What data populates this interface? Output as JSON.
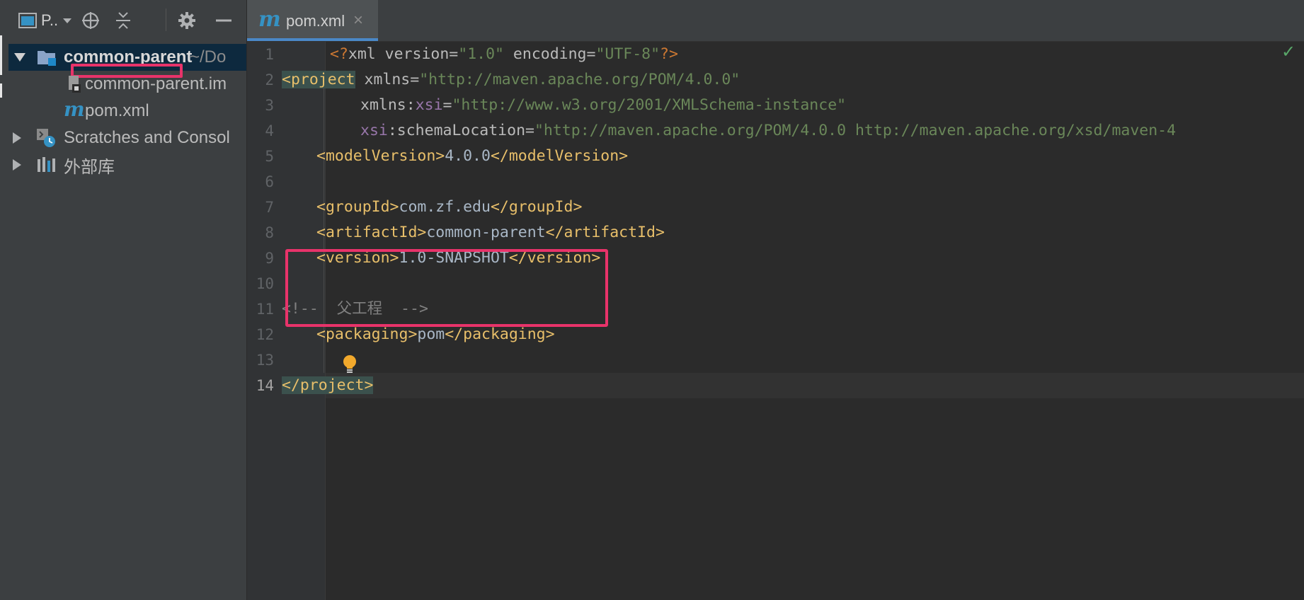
{
  "project_panel": {
    "title": "P..",
    "tree": [
      {
        "label": "common-parent",
        "suffix": "~/Do",
        "expanded": true,
        "selected": true
      },
      {
        "label": "common-parent.im"
      },
      {
        "label": "pom.xml",
        "icon_glyph": "m"
      },
      {
        "label": "Scratches and Consol"
      },
      {
        "label": "外部库"
      }
    ]
  },
  "tab": {
    "icon_glyph": "m",
    "label": "pom.xml",
    "close": "×"
  },
  "editor": {
    "line_numbers": [
      "1",
      "2",
      "3",
      "4",
      "5",
      "6",
      "7",
      "8",
      "9",
      "10",
      "11",
      "12",
      "13",
      "14"
    ],
    "current_line": "14",
    "inspection_status": "✓"
  },
  "code": {
    "l1": {
      "open": "<?",
      "name": "xml",
      "a1": " version",
      "eq1": "=",
      "v1": "\"1.0\"",
      "a2": " encoding",
      "eq2": "=",
      "v2": "\"UTF-8\"",
      "close": "?>"
    },
    "l2": {
      "tag": "<project",
      "attr": " xmlns",
      "eq": "=",
      "val": "\"http://maven.apache.org/POM/4.0.0\""
    },
    "l3": {
      "attr": "xmlns",
      "colon": ":",
      "ns": "xsi",
      "eq": "=",
      "val": "\"http://www.w3.org/2001/XMLSchema-instance\""
    },
    "l4": {
      "ns": "xsi",
      "colon": ":",
      "attr": "schemaLocation",
      "eq": "=",
      "val": "\"http://maven.apache.org/POM/4.0.0 http://maven.apache.org/xsd/maven-4"
    },
    "l5": {
      "open": "<modelVersion>",
      "text": "4.0.0",
      "close": "</modelVersion>"
    },
    "l7": {
      "open": "<groupId>",
      "text": "com.zf.edu",
      "close": "</groupId>"
    },
    "l8": {
      "open": "<artifactId>",
      "text": "common-parent",
      "close": "</artifactId>"
    },
    "l9": {
      "open": "<version>",
      "text": "1.0-SNAPSHOT",
      "close": "</version>"
    },
    "l11": {
      "comment": "<!--  父工程  -->"
    },
    "l12": {
      "open": "<packaging>",
      "text": "pom",
      "close": "</packaging>"
    },
    "l14": {
      "close": "</project>"
    }
  },
  "browsers": [
    {
      "icon": "chrome-icon"
    },
    {
      "icon": "firefox-icon"
    },
    {
      "icon": "safari-icon"
    },
    {
      "icon": "opera-icon"
    }
  ],
  "colors": {
    "highlight_box": "#e8336a",
    "tag": "#e8bf6a",
    "string": "#6a8759",
    "namespace": "#9876aa",
    "comment": "#808080",
    "selection": "#0d293e",
    "tab_underline": "#4a88c7"
  }
}
